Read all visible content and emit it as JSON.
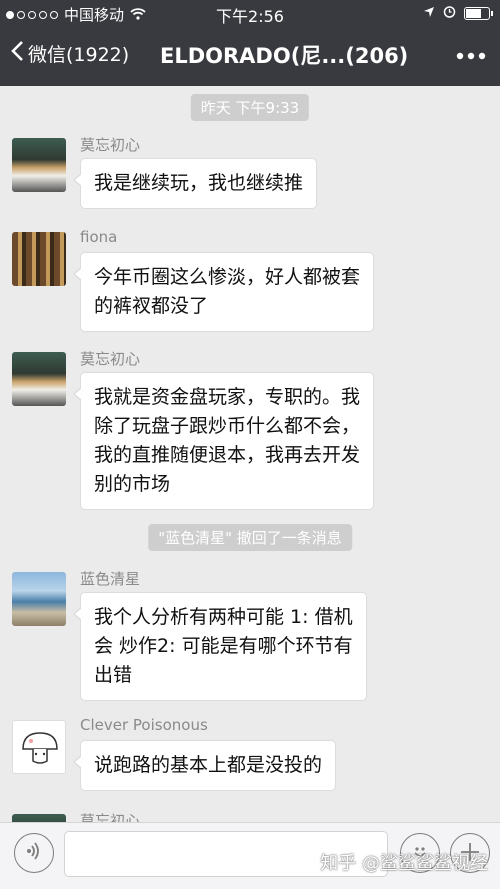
{
  "status_bar": {
    "carrier": "中国移动",
    "time": "下午2:56",
    "signal_bars_filled": 1,
    "signal_bars_total": 5,
    "battery_level": 0.72
  },
  "nav": {
    "back_label": "微信(1922)",
    "title": "ELDORADO(尼...(206)"
  },
  "chat": {
    "timestamp": "昨天 下午9:33",
    "recall_notice": "\"蓝色清星\" 撤回了一条消息",
    "messages": [
      {
        "sender": "莫忘初心",
        "lines": [
          "我是继续玩，我也继续推"
        ],
        "avatar": "room-photo"
      },
      {
        "sender": "fiona",
        "lines": [
          "今年币圈这么惨淡，好人都被套",
          "的裤衩都没了"
        ],
        "avatar": "shelf-photo"
      },
      {
        "sender": "莫忘初心",
        "lines": [
          "我就是资金盘玩家，专职的。我",
          "除了玩盘子跟炒币什么都不会，",
          "我的直推随便退本，我再去开发",
          "别的市场"
        ],
        "avatar": "room-photo"
      },
      {
        "sender": "蓝色清星",
        "lines": [
          "我个人分析有两种可能 1:  借机",
          "会 炒作2: 可能是有哪个环节有",
          "出错"
        ],
        "avatar": "beach-photo"
      },
      {
        "sender": "Clever Poisonous",
        "lines": [
          "说跑路的基本上都是没投的"
        ],
        "avatar": "mushroom-sticker"
      },
      {
        "sender": "莫忘初心",
        "lines": [],
        "avatar": "room-photo"
      }
    ]
  },
  "input_bar": {
    "watermark": "知乎 @鲨鲨鲨鲨视经"
  },
  "icons": {
    "back": "chevron-left-icon",
    "more": "more-dots-icon",
    "voice": "voice-icon",
    "emoji": "emoji-icon",
    "plus": "plus-icon",
    "wifi": "wifi-icon",
    "location": "location-arrow-icon",
    "alarm": "alarm-icon"
  }
}
